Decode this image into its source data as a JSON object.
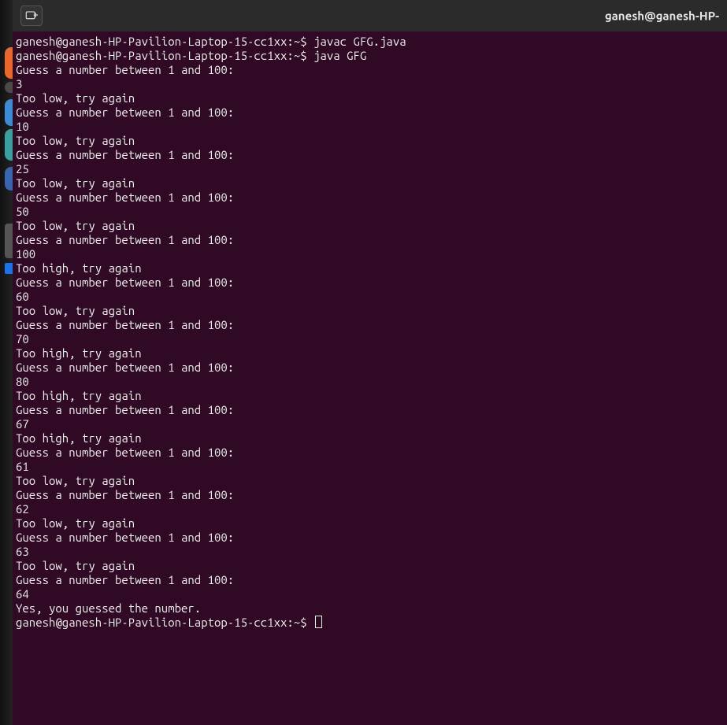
{
  "titlebar": {
    "title": "ganesh@ganesh-HP-"
  },
  "prompt": {
    "userhost": "ganesh@ganesh-HP-Pavilion-Laptop-15-cc1xx",
    "path": "~",
    "sep": ":",
    "dollar": "$"
  },
  "commands": {
    "compile": "javac GFG.java",
    "run": "java GFG"
  },
  "game": {
    "prompt": "Guess a number between 1 and 100:",
    "too_low": "Too low, try again",
    "too_high": "Too high, try again",
    "win": "Yes, you guessed the number.",
    "guesses": [
      {
        "guess": "3",
        "result": "low"
      },
      {
        "guess": "10",
        "result": "low"
      },
      {
        "guess": "25",
        "result": "low"
      },
      {
        "guess": "50",
        "result": "low"
      },
      {
        "guess": "100",
        "result": "high"
      },
      {
        "guess": "60",
        "result": "low"
      },
      {
        "guess": "70",
        "result": "high"
      },
      {
        "guess": "80",
        "result": "high"
      },
      {
        "guess": "67",
        "result": "high"
      },
      {
        "guess": "61",
        "result": "low"
      },
      {
        "guess": "62",
        "result": "low"
      },
      {
        "guess": "63",
        "result": "low"
      },
      {
        "guess": "64",
        "result": "win"
      }
    ]
  }
}
